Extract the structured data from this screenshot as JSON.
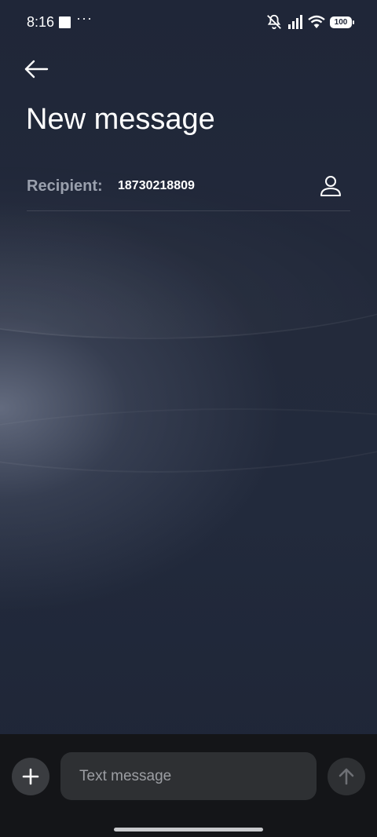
{
  "status_bar": {
    "time": "8:16",
    "more_indicator": "···",
    "battery_level": "100",
    "icons": [
      "notification-square-icon",
      "mute-bell-icon",
      "signal-icon",
      "wifi-icon",
      "battery-icon"
    ]
  },
  "header": {
    "back_icon": "arrow-left-icon",
    "title": "New message"
  },
  "recipient": {
    "label": "Recipient:",
    "value": "18730218809",
    "contact_icon": "person-icon"
  },
  "compose": {
    "attach_icon": "plus-icon",
    "placeholder": "Text message",
    "send_icon": "arrow-up-icon"
  },
  "colors": {
    "background": "#1f2638",
    "compose_bar": "#141518",
    "field": "#2e3033",
    "label_gray": "#9aa0ad"
  }
}
